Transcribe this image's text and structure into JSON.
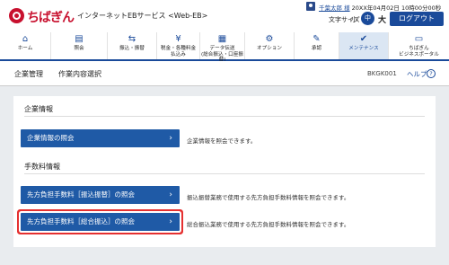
{
  "header": {
    "bank_logo": "ちばぎん",
    "service_name": "インターネットEBサービス <Web-EB>",
    "user_name": "千葉太郎 様",
    "login_time": "20XX年04月02日 10時00分00秒",
    "font_size_label": "文字サイズ",
    "font_small": "小",
    "font_medium": "中",
    "font_large": "大",
    "logout_label": "ログアウト"
  },
  "nav": {
    "items": [
      {
        "label": "ホーム",
        "icon": "⌂"
      },
      {
        "label": "照会",
        "icon": "▤"
      },
      {
        "label": "振込・振替",
        "icon": "⇆"
      },
      {
        "label": "税金・各種料金\n払込み",
        "icon": "¥"
      },
      {
        "label": "データ伝送\n(総合振込・口座振替)",
        "icon": "▦"
      },
      {
        "label": "オプション",
        "icon": "⚙"
      },
      {
        "label": "承認",
        "icon": "✎"
      },
      {
        "label": "メンテナンス",
        "icon": "✔"
      },
      {
        "label": "ちばぎん\nビジネスポータル",
        "icon": "▭"
      }
    ],
    "active_index": 7
  },
  "page": {
    "title": "企業管理",
    "subtitle": "作業内容選択",
    "screen_id": "BKGK001",
    "help_label": "ヘルプ"
  },
  "sections": {
    "company": {
      "title": "企業情報",
      "button": "企業情報の照会",
      "description": "企業情報を照会できます。"
    },
    "fee": {
      "title": "手数料情報",
      "button1": "先方負担手数料［振込振替］の照会",
      "desc1": "振込振替業務で使用する先方負担手数料情報を照会できます。",
      "button2": "先方負担手数料［総合振込］の照会",
      "desc2": "総合振込業務で使用する先方負担手数料情報を照会できます。"
    }
  },
  "colors": {
    "primary": "#1a4a9a",
    "button": "#1f5aa6",
    "brand": "#c8102e",
    "highlight": "#e53030"
  }
}
